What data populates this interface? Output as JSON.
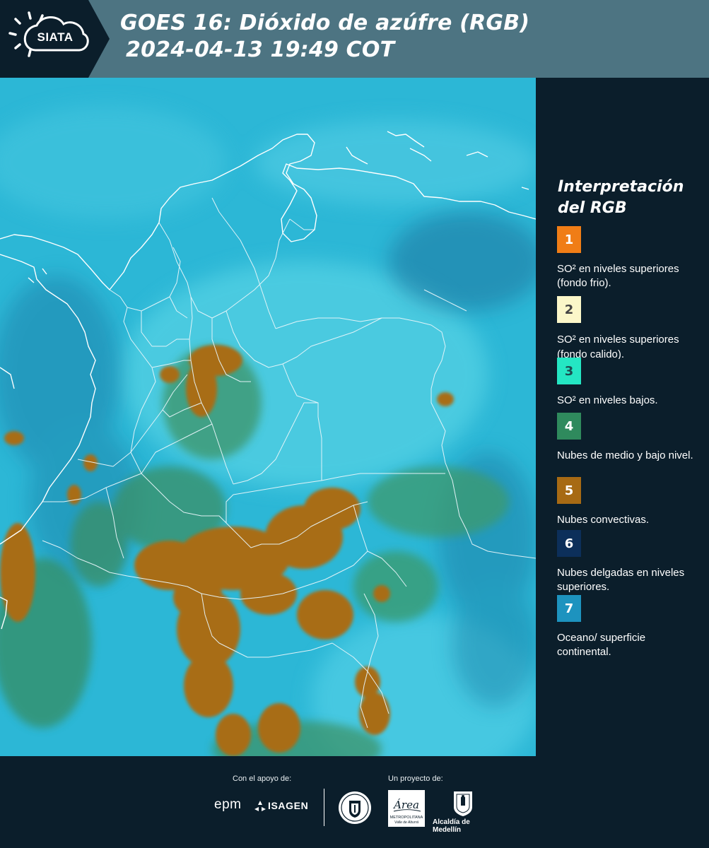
{
  "header": {
    "logo_text": "SIATA",
    "title_line1": "GOES 16: Dióxido de azúfre (RGB)",
    "title_line2": "2024-04-13 19:49 COT"
  },
  "legend": {
    "title_line1": "Interpretación",
    "title_line2": "del RGB",
    "items": [
      {
        "number": "1",
        "color": "#f07d16",
        "text_color": "#ffffff",
        "label": "SO² en niveles superiores (fondo frio)."
      },
      {
        "number": "2",
        "color": "#fbf7c9",
        "text_color": "#444444",
        "label": "SO² en niveles superiores (fondo calido)."
      },
      {
        "number": "3",
        "color": "#24e6c3",
        "text_color": "#1d4b50",
        "label": "SO² en niveles bajos."
      },
      {
        "number": "4",
        "color": "#2f8a5d",
        "text_color": "#ffffff",
        "label": "Nubes de medio y bajo nivel."
      },
      {
        "number": "5",
        "color": "#a76a14",
        "text_color": "#ffffff",
        "label": "Nubes convectivas."
      },
      {
        "number": "6",
        "color": "#0c2f5a",
        "text_color": "#ffffff",
        "label": "Nubes delgadas en niveles superiores."
      },
      {
        "number": "7",
        "color": "#1d93bf",
        "text_color": "#ffffff",
        "label": "Oceano/ superficie continental."
      }
    ]
  },
  "footer": {
    "support_label": "Con el apoyo de:",
    "project_label": "Un proyecto de:",
    "epm_text": "epm",
    "isagen_text": "ISAGEN",
    "area_text": "Área",
    "area_subtext": "METROPOLITANA",
    "area_subtext2": "Valle de Aburrá",
    "alcaldia_text": "Alcaldía de Medellín"
  },
  "colors": {
    "header_bg": "#4d7482",
    "panel_bg": "#0b1e2b",
    "ocean": "#2bb8d6",
    "convective": "#a76a14",
    "mid_cloud": "#2f8a5d"
  }
}
